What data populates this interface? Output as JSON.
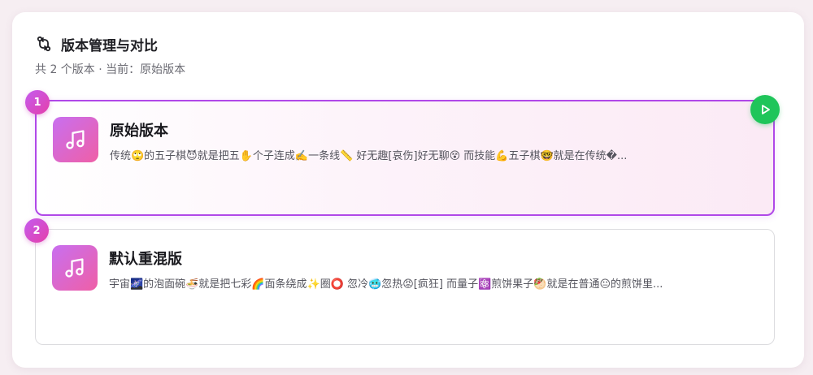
{
  "panel": {
    "title": "版本管理与对比",
    "title_icon": "git-compare-icon",
    "subtitle": "共 2 个版本 · 当前：原始版本"
  },
  "versions": [
    {
      "index": "1",
      "title": "原始版本",
      "description": "传统🙄的五子棋😈就是把五✋个子连成✍️一条线📏 好无趣[哀伤]好无聊😵 而技能💪五子棋🤓就是在传统�...",
      "icon": "music-note-icon",
      "active": true,
      "action_icon": "play-icon"
    },
    {
      "index": "2",
      "title": "默认重混版",
      "description": "宇宙🌌的泡面碗🍜就是把七彩🌈面条绕成✨圈⭕ 忽冷🥶忽热😡[疯狂] 而量子⚛️煎饼果子🥙就是在普通😐的煎饼里...",
      "icon": "music-note-icon",
      "active": false
    }
  ],
  "colors": {
    "accent_purple": "#b048e8",
    "accent_pink": "#e53fa9",
    "play_green": "#1fc55a"
  }
}
